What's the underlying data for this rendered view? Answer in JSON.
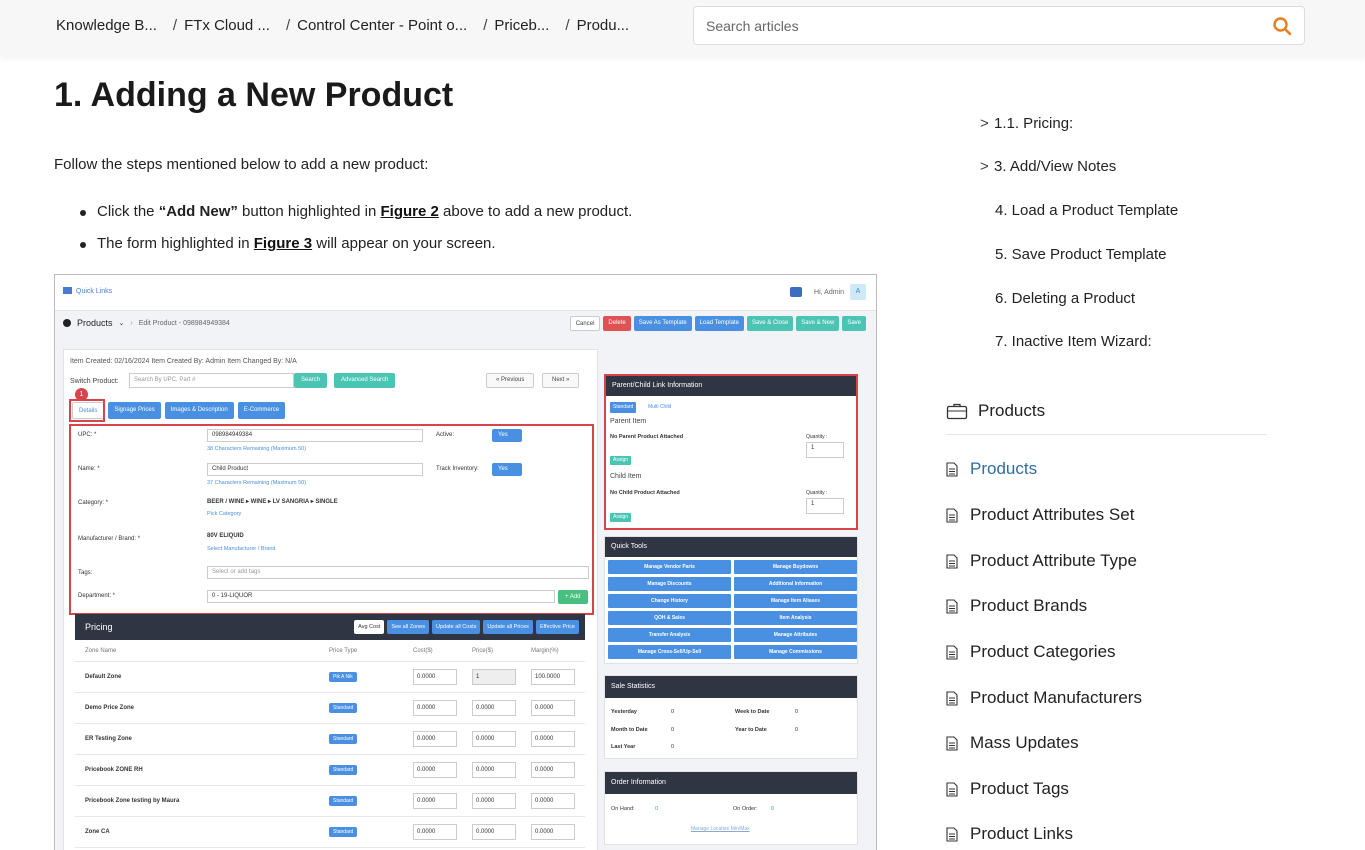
{
  "breadcrumb": [
    "Knowledge B...",
    "FTx Cloud ...",
    "Control Center - Point o...",
    "Priceb...",
    "Produ..."
  ],
  "search": {
    "placeholder": "Search articles"
  },
  "article": {
    "title": "1. Adding a New Product",
    "intro": "Follow the steps mentioned below to add a new product:",
    "bullet1": {
      "pre": "Click the ",
      "bold": "“Add New”",
      "mid": " button highlighted in ",
      "link": "Figure 2",
      "post": " above to add a new product."
    },
    "bullet2": {
      "pre": "The form highlighted in ",
      "link": "Figure 3",
      "post": " will appear on your screen."
    }
  },
  "screenshot": {
    "quick_links": "Quick Links",
    "user": "Hi, Admin",
    "avatar": "A",
    "products": "Products",
    "edit_crumb": "Edit Product - 098984949384",
    "actions": [
      "Cancel",
      "Delete",
      "Save As Template",
      "Load Template",
      "Save & Close",
      "Save & New",
      "Save"
    ],
    "meta": "Item Created: 02/16/2024   Item Created By: Admin   Item Changed By: N/A",
    "switch_label": "Switch Product:",
    "switch_placeholder": "Search By UPC, Part #",
    "search_btn": "Search",
    "adv_search": "Advanced Search",
    "prev": "« Previous",
    "next": "Next »",
    "badge": "1",
    "tabs": [
      "Details",
      "Signage Prices",
      "Images & Description",
      "E-Commerce"
    ],
    "upc_label": "UPC: *",
    "upc_value": "098984949384",
    "upc_hint": "38 Characters Remaining (Maximum 50)",
    "active_label": "Active:",
    "yes": "Yes",
    "name_label": "Name: *",
    "name_value": "Child Product",
    "name_hint": "37 Characters Remaining (Maximum 50)",
    "track_label": "Track Inventory:",
    "category_label": "Category: *",
    "category_value": "BEER / WINE ▸ WINE ▸ LV SANGRIA ▸ SINGLE",
    "pick_category": "Pick Category",
    "brand_label": "Manufacturer / Brand: *",
    "brand_value": "80V ELIQUID",
    "select_brand": "Select Manufacturer / Brand",
    "tags_label": "Tags:",
    "tags_placeholder": "Select or add tags",
    "dept_label": "Department: *",
    "dept_value": "0 - 19-LIQUOR",
    "add": "+ Add",
    "pricing": {
      "title": "Pricing",
      "buttons": [
        "Avg Cost",
        "See all Zones",
        "Update all Costs",
        "Update all Prices",
        "Effective Price"
      ],
      "columns": [
        "Zone Name",
        "Price Type",
        "Cost($)",
        "Price($)",
        "Margin(%)"
      ],
      "rows": [
        {
          "zone": "Default Zone",
          "type": "Pik A Nik",
          "cost": "0.0000",
          "price": "1",
          "margin": "100.0000"
        },
        {
          "zone": "Demo Price Zone",
          "type": "Standard",
          "cost": "0.0000",
          "price": "0.0000",
          "margin": "0.0000"
        },
        {
          "zone": "ER Testing Zone",
          "type": "Standard",
          "cost": "0.0000",
          "price": "0.0000",
          "margin": "0.0000"
        },
        {
          "zone": "Pricebook ZONE RH",
          "type": "Standard",
          "cost": "0.0000",
          "price": "0.0000",
          "margin": "0.0000"
        },
        {
          "zone": "Pricebook Zone testing by Maura",
          "type": "Standard",
          "cost": "0.0000",
          "price": "0.0000",
          "margin": "0.0000"
        },
        {
          "zone": "Zone CA",
          "type": "Standard",
          "cost": "0.0000",
          "price": "0.0000",
          "margin": "0.0000"
        }
      ]
    },
    "parent_child": {
      "title": "Parent/Child Link Information",
      "standard": "Standard",
      "multi": "Multi Child",
      "parent_item": "Parent Item",
      "no_parent": "No Parent Product Attached",
      "quantity": "Quantity :",
      "qty_value": "1",
      "assign": "Assign",
      "child_item": "Child Item",
      "no_child": "No Child Product Attached"
    },
    "quick_tools": {
      "title": "Quick Tools",
      "items": [
        "Manage Vendor Parts",
        "Manage Buydowns",
        "Manage Discounts",
        "Additional Information",
        "Change History",
        "Manage Item Aliases",
        "QOH & Sales",
        "Item Analysis",
        "Transfer Analysis",
        "Manage Attributes",
        "Manage Cross-Sell/Up-Sell",
        "Manage Commissions"
      ]
    },
    "sale_stats": {
      "title": "Sale Statistics",
      "yesterday": "Yesterday",
      "yesterday_v": "0",
      "week": "Week to Date",
      "week_v": "0",
      "month": "Month to Date",
      "month_v": "0",
      "year_to": "Year to Date",
      "year_to_v": "0",
      "last_year": "Last Year",
      "last_year_v": "0"
    },
    "order_info": {
      "title": "Order Information",
      "on_hand": "On Hand:",
      "on_hand_v": "0",
      "on_order": "On Order:",
      "on_order_v": "0",
      "manage": "Manage Location Min/Max"
    }
  },
  "toc": [
    {
      "label": "1.1. Pricing:",
      "chevron": ">"
    },
    {
      "label": "3. Add/View Notes",
      "chevron": ">"
    },
    {
      "label": "4. Load a Product Template",
      "chevron": ""
    },
    {
      "label": "5. Save Product Template",
      "chevron": ""
    },
    {
      "label": "6. Deleting a Product",
      "chevron": ""
    },
    {
      "label": "7. Inactive Item Wizard:",
      "chevron": ""
    }
  ],
  "section": "Products",
  "links": [
    "Products",
    "Product Attributes Set",
    "Product Attribute Type",
    "Product Brands",
    "Product Categories",
    "Product Manufacturers",
    "Mass Updates",
    "Product Tags",
    "Product Links"
  ],
  "colors": {
    "accent": "#e67e22",
    "link_active": "#2e6da4",
    "highlight": "#d9434c",
    "primary": "#4a90e2",
    "dark_header": "#2f3542"
  }
}
